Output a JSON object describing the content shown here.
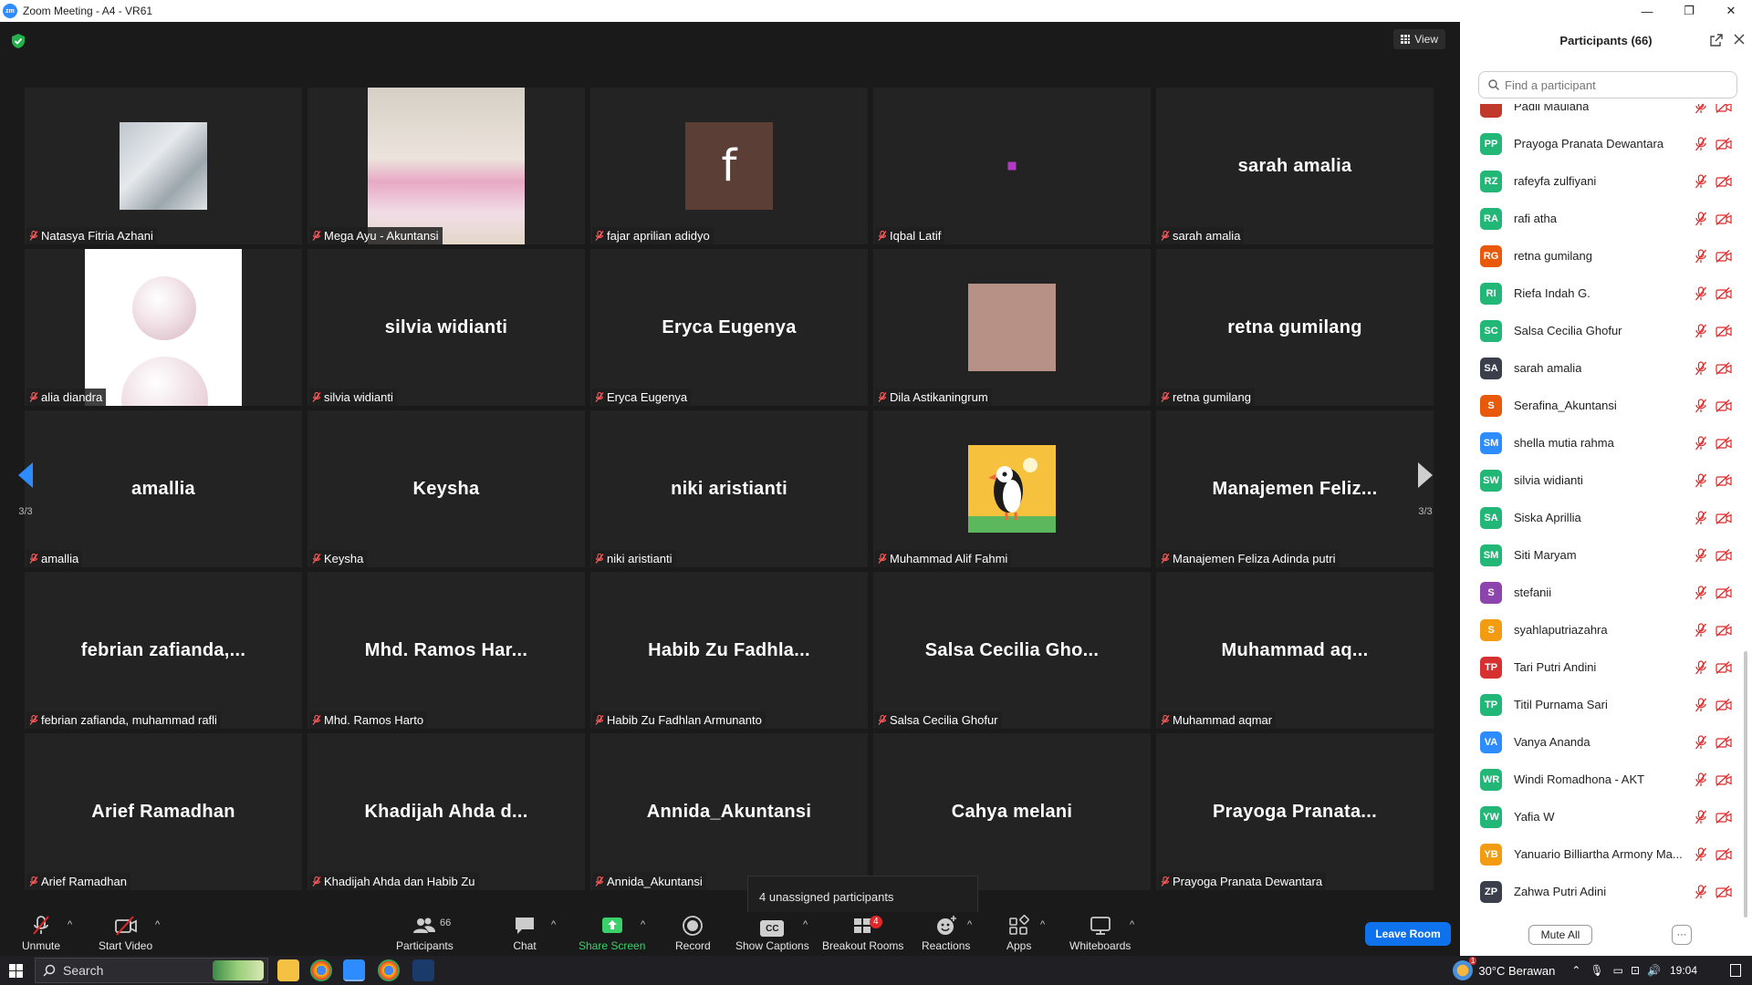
{
  "window": {
    "app_logo": "zm",
    "title": "Zoom Meeting - A4 - VR61",
    "controls": [
      "—",
      "❐",
      "✕"
    ]
  },
  "meeting": {
    "view_label": "View",
    "pager_left": "3/3",
    "pager_right": "3/3",
    "tiles": [
      {
        "center": "",
        "name": "Natasya Fitria Azhani",
        "image": "cat-photo"
      },
      {
        "center": "",
        "name": "Mega Ayu - Akuntansi",
        "image": "kitten-photo"
      },
      {
        "center": "",
        "name": "fajar aprilian adidyo",
        "image": "letter-f",
        "letter": "f"
      },
      {
        "center": "",
        "name": "Iqbal Latif",
        "image": "dot"
      },
      {
        "center": "sarah amalia",
        "name": "sarah amalia",
        "image": ""
      },
      {
        "center": "",
        "name": "alia diandra",
        "image": "bubbles-photo"
      },
      {
        "center": "silvia widianti",
        "name": "silvia widianti",
        "image": ""
      },
      {
        "center": "Eryca Eugenya",
        "name": "Eryca Eugenya",
        "image": ""
      },
      {
        "center": "",
        "name": "Dila Astikaningrum",
        "image": "skin-photo"
      },
      {
        "center": "retna gumilang",
        "name": "retna gumilang",
        "image": ""
      },
      {
        "center": "amallia",
        "name": "amallia",
        "image": ""
      },
      {
        "center": "Keysha",
        "name": "Keysha",
        "image": ""
      },
      {
        "center": "niki aristianti",
        "name": "niki aristianti",
        "image": ""
      },
      {
        "center": "",
        "name": "Muhammad Alif Fahmi",
        "image": "puffin-avatar"
      },
      {
        "center": "Manajemen  Feliz...",
        "name": "Manajemen Feliza Adinda putri",
        "image": ""
      },
      {
        "center": "febrian  zafianda,...",
        "name": "febrian zafianda, muhammad rafli",
        "image": ""
      },
      {
        "center": "Mhd.  Ramos  Har...",
        "name": "Mhd. Ramos Harto",
        "image": ""
      },
      {
        "center": "Habib  Zu  Fadhla...",
        "name": "Habib Zu Fadhlan Armunanto",
        "image": ""
      },
      {
        "center": "Salsa  Cecilia  Gho...",
        "name": "Salsa Cecilia Ghofur",
        "image": ""
      },
      {
        "center": "Muhammad  aq...",
        "name": "Muhammad aqmar",
        "image": ""
      },
      {
        "center": "Arief Ramadhan",
        "name": "Arief Ramadhan",
        "image": ""
      },
      {
        "center": "Khadijah  Ahda  d...",
        "name": "Khadijah Ahda dan Habib Zu",
        "image": ""
      },
      {
        "center": "Annida_Akuntansi",
        "name": "Annida_Akuntansi",
        "image": ""
      },
      {
        "center": "Cahya melani",
        "name": "",
        "image": ""
      },
      {
        "center": "Prayoga  Pranata...",
        "name": "Prayoga Pranata Dewantara",
        "image": ""
      }
    ],
    "popup": "4 unassigned participants"
  },
  "toolbar": {
    "unmute": "Unmute",
    "start_video": "Start Video",
    "participants": "Participants",
    "participants_count": "66",
    "chat": "Chat",
    "share_screen": "Share Screen",
    "record": "Record",
    "show_captions": "Show Captions",
    "captions_glyph": "CC",
    "breakout_rooms": "Breakout Rooms",
    "breakout_badge": "4",
    "reactions": "Reactions",
    "apps": "Apps",
    "whiteboards": "Whiteboards",
    "leave_room": "Leave Room",
    "caret": "^"
  },
  "panel": {
    "title": "Participants (66)",
    "search_placeholder": "Find a participant",
    "mute_all": "Mute All",
    "more": "···",
    "participants": [
      {
        "initials": "",
        "name": "Padli Maulana",
        "color": "#c0392b"
      },
      {
        "initials": "PP",
        "name": "Prayoga Pranata Dewantara",
        "color": "#23b777"
      },
      {
        "initials": "RZ",
        "name": "rafeyfa zulfiyani",
        "color": "#23b777"
      },
      {
        "initials": "RA",
        "name": "rafi atha",
        "color": "#23b777"
      },
      {
        "initials": "RG",
        "name": "retna gumilang",
        "color": "#e8590c"
      },
      {
        "initials": "RI",
        "name": "Riefa Indah G.",
        "color": "#23b777"
      },
      {
        "initials": "SC",
        "name": "Salsa Cecilia Ghofur",
        "color": "#23b777"
      },
      {
        "initials": "SA",
        "name": "sarah amalia",
        "color": "#3a3f4b"
      },
      {
        "initials": "S",
        "name": "Serafina_Akuntansi",
        "color": "#e8590c"
      },
      {
        "initials": "SM",
        "name": "shella mutia rahma",
        "color": "#2d8cff"
      },
      {
        "initials": "SW",
        "name": "silvia widianti",
        "color": "#23b777"
      },
      {
        "initials": "SA",
        "name": "Siska Aprillia",
        "color": "#23b777"
      },
      {
        "initials": "SM",
        "name": "Siti Maryam",
        "color": "#23b777"
      },
      {
        "initials": "S",
        "name": "stefanii",
        "color": "#8e44ad"
      },
      {
        "initials": "S",
        "name": "syahlaputriazahra",
        "color": "#f39c12"
      },
      {
        "initials": "TP",
        "name": "Tari Putri Andini",
        "color": "#d63031"
      },
      {
        "initials": "TP",
        "name": "Titil Purnama Sari",
        "color": "#23b777"
      },
      {
        "initials": "VA",
        "name": "Vanya Ananda",
        "color": "#2d8cff"
      },
      {
        "initials": "WR",
        "name": "Windi Romadhona - AKT",
        "color": "#23b777"
      },
      {
        "initials": "YW",
        "name": "Yafia W",
        "color": "#23b777"
      },
      {
        "initials": "YB",
        "name": "Yanuario Billiartha Armony Ma...",
        "color": "#f39c12"
      },
      {
        "initials": "ZP",
        "name": "Zahwa Putri Adini",
        "color": "#3a3f4b"
      }
    ]
  },
  "taskbar": {
    "search_placeholder": "Search",
    "weather": "30°C Berawan",
    "time": "19:04",
    "weather_badge": "1"
  },
  "colors": {
    "accent": "#2d8cff",
    "leave": "#0e72ed",
    "muted_red": "#e02828",
    "share_green": "#3ad16b"
  }
}
